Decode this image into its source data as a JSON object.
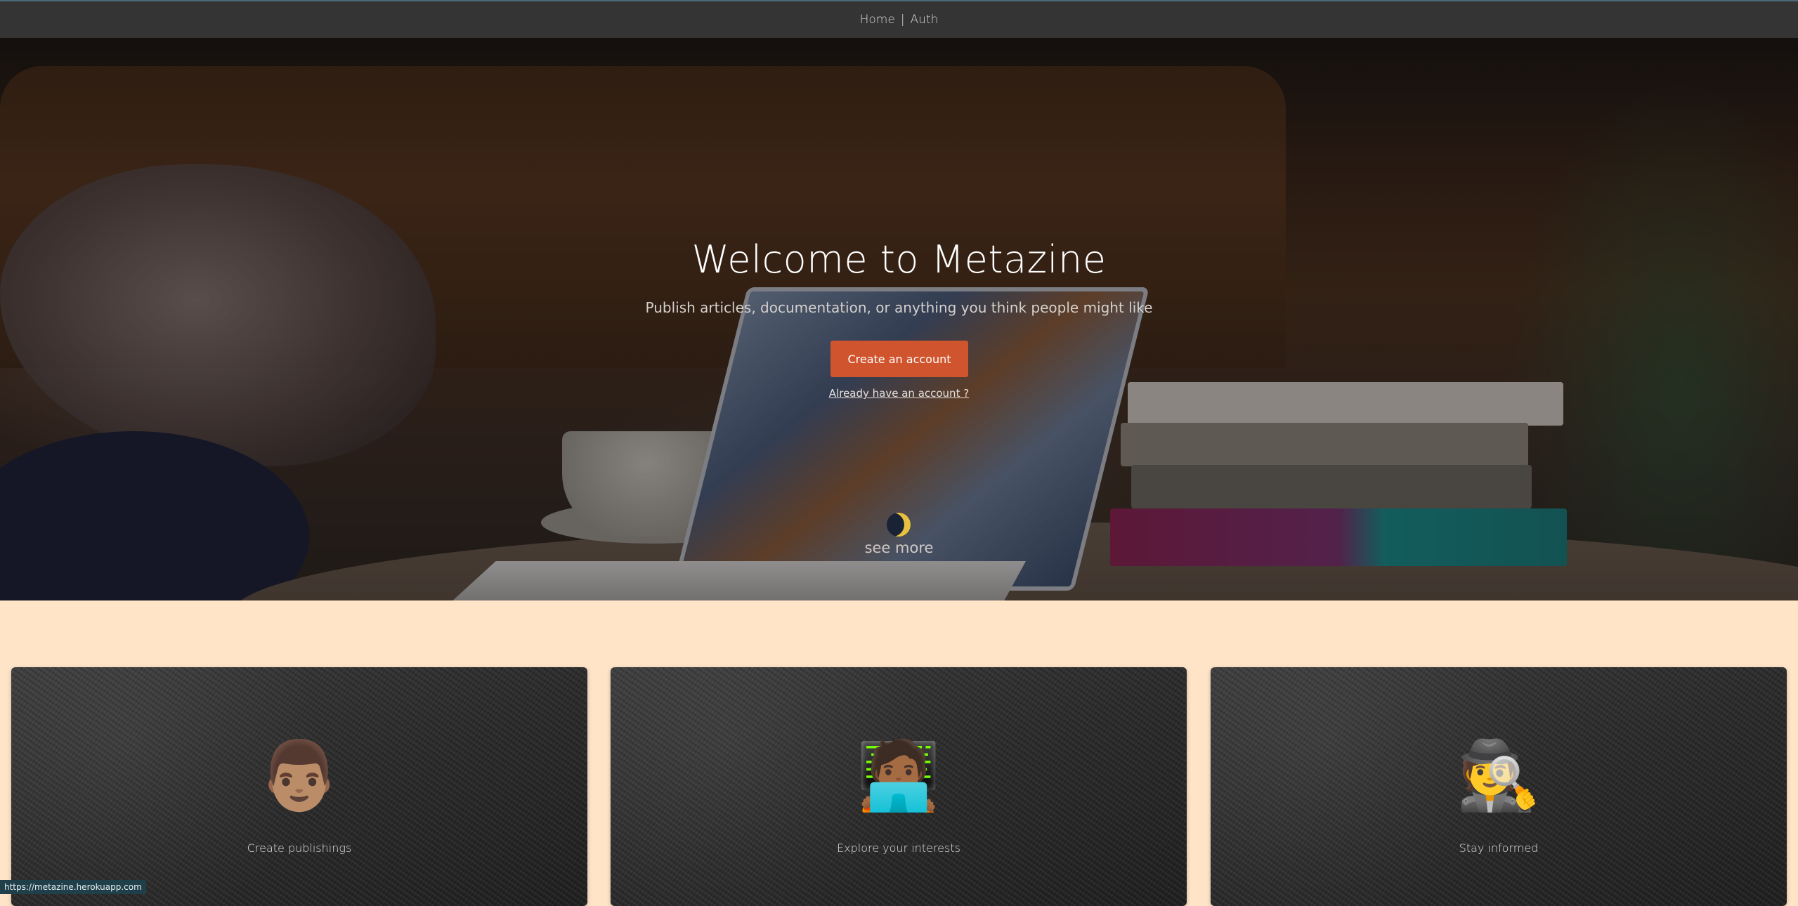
{
  "nav": {
    "home_label": "Home",
    "separator": "|",
    "auth_label": "Auth"
  },
  "hero": {
    "title": "Welcome to Metazine",
    "subtitle": "Publish articles, documentation, or anything you think people might like",
    "cta_label": "Create an account",
    "login_link": "Already have an account ?",
    "see_more": "see more",
    "theme_icon": "moon-icon"
  },
  "features": [
    {
      "icon": "man-emoji-icon",
      "emoji": "👨🏽",
      "label": "Create publishings"
    },
    {
      "icon": "technologist-emoji-icon",
      "emoji": "🧑🏾‍💻",
      "label": "Explore your interests"
    },
    {
      "icon": "detective-emoji-icon",
      "emoji": "🕵️",
      "label": "Stay informed"
    }
  ],
  "status": {
    "url": "https://metazine.herokuapp.com"
  },
  "colors": {
    "topbar_bg": "#343434",
    "cta": "#d0552e",
    "page_bg": "#ffe4c8"
  }
}
